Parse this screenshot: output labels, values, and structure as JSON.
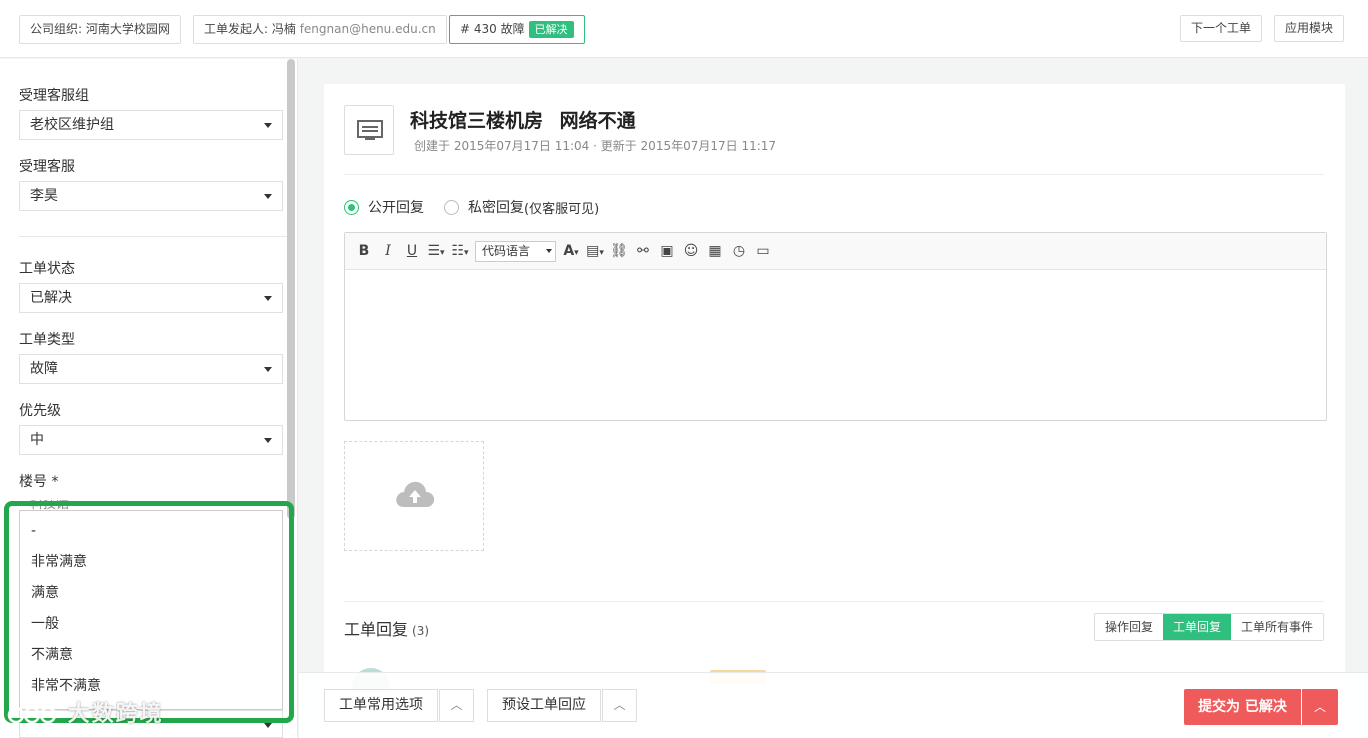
{
  "header": {
    "org": "公司组织: 河南大学校园网",
    "initiator_label": "工单发起人: 冯楠",
    "initiator_email": "fengnan@henu.edu.cn",
    "ticket_no": "# 430 故障",
    "ticket_status": "已解决",
    "next_ticket": "下一个工单",
    "app_module": "应用模块"
  },
  "sidebar": {
    "group_label": "受理客服组",
    "group_value": "老校区维护组",
    "agent_label": "受理客服",
    "agent_value": "李昊",
    "status_label": "工单状态",
    "status_value": "已解决",
    "type_label": "工单类型",
    "type_value": "故障",
    "priority_label": "优先级",
    "priority_value": "中",
    "building_label": "楼号 *",
    "building_value_cut": "科技馆",
    "satisfaction_options": [
      "-",
      "非常满意",
      "满意",
      "一般",
      "不满意",
      "非常不满意"
    ]
  },
  "ticket": {
    "title": "科技馆三楼机房 网络不通",
    "meta": "创建于 2015年07月17日 11:04 · 更新于 2015年07月17日 11:17"
  },
  "reply": {
    "public": "公开回复",
    "private": "私密回复",
    "private_note": "(仅客服可见)",
    "code_language": "代码语言"
  },
  "replies": {
    "title": "工单回复",
    "count": "(3)",
    "tabs": [
      "操作回复",
      "工单回复",
      "工单所有事件"
    ],
    "active_tab": "工单回复"
  },
  "bottom": {
    "common_options": "工单常用选项",
    "preset_reply": "预设工单回应",
    "submit": "提交为 已解决"
  },
  "watermark": "大数跨境",
  "colors": {
    "accent": "#2fbf7f",
    "danger": "#ef5a5a",
    "highlight": "#22a84a"
  }
}
